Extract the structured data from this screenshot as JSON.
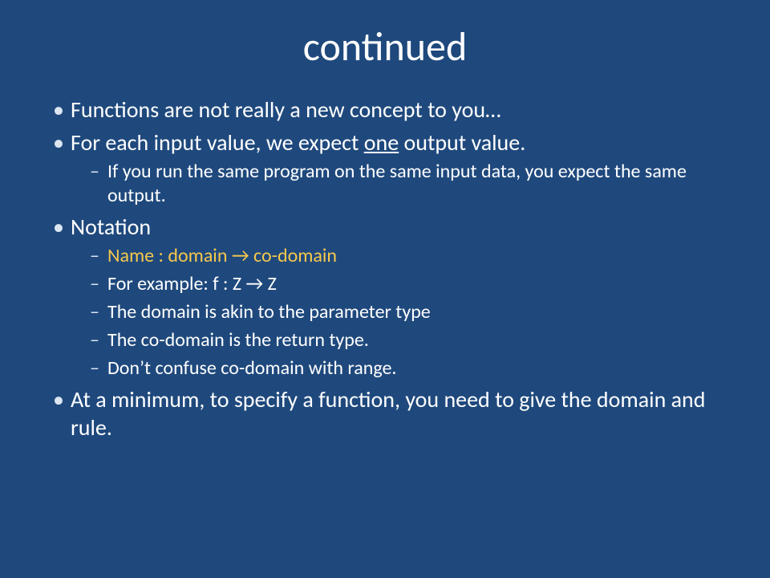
{
  "title": "continued",
  "bullets": {
    "b1": "Functions are not really a new concept to you…",
    "b2_pre": "For each input value, we expect ",
    "b2_underlined": "one",
    "b2_post": " output value.",
    "b2_sub1": "If you run the same program on the same input data, you expect the same output.",
    "b3": "Notation",
    "b3_sub1": "Name : domain → co-domain",
    "b3_sub2": "For example:  f : Z → Z",
    "b3_sub3": "The domain is akin to the parameter type",
    "b3_sub4": "The co-domain is the return type.",
    "b3_sub5": "Don’t confuse co-domain with range.",
    "b4": "At a minimum, to specify a function, you need to give the domain and rule."
  }
}
